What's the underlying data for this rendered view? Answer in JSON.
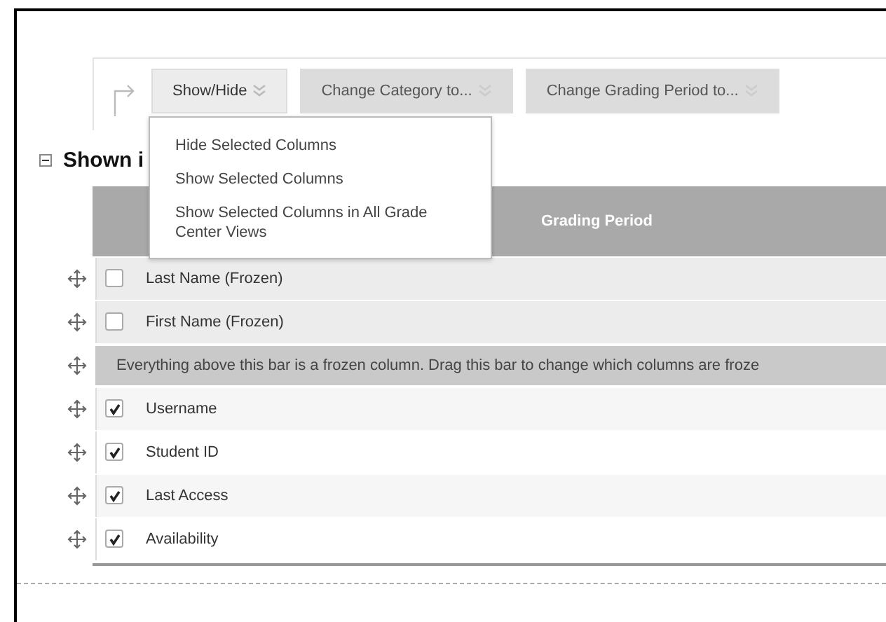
{
  "toolbar": {
    "buttons": [
      {
        "label": "Show/Hide",
        "active": true
      },
      {
        "label": "Change Category to...",
        "active": false
      },
      {
        "label": "Change Grading Period to...",
        "active": false
      }
    ]
  },
  "menu": {
    "items": [
      "Hide Selected Columns",
      "Show Selected Columns",
      "Show Selected Columns in All Grade Center Views"
    ]
  },
  "section": {
    "title": "Shown i",
    "expanded": true
  },
  "table": {
    "columns": [
      "Grading Period"
    ],
    "rows": [
      {
        "kind": "column",
        "label": "Last Name (Frozen)",
        "checked": false
      },
      {
        "kind": "column",
        "label": "First Name (Frozen)",
        "checked": false
      },
      {
        "kind": "divider",
        "label": "Everything above this bar is a frozen column. Drag this bar to change which columns are froze"
      },
      {
        "kind": "column",
        "label": "Username",
        "checked": true
      },
      {
        "kind": "column",
        "label": "Student ID",
        "checked": true
      },
      {
        "kind": "column",
        "label": "Last Access",
        "checked": true
      },
      {
        "kind": "column",
        "label": "Availability",
        "checked": true
      }
    ]
  }
}
